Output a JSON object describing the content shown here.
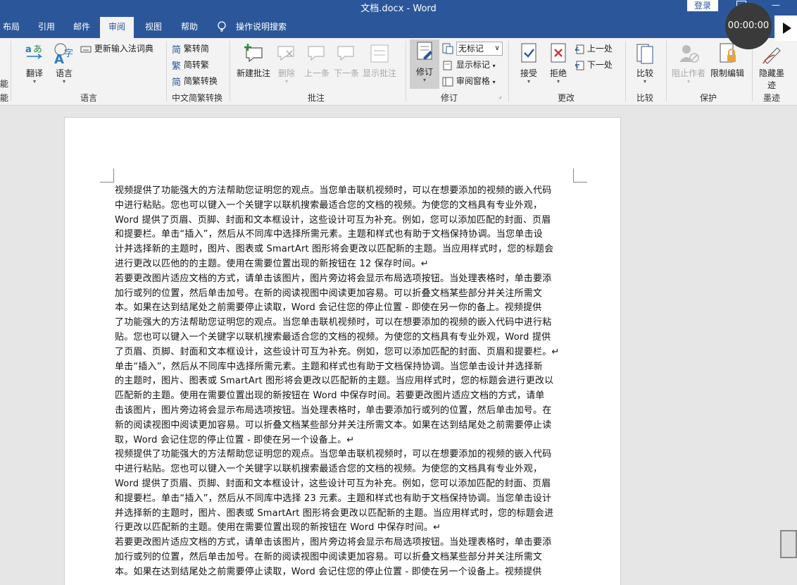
{
  "window": {
    "title": "文档.docx  -  Word",
    "login_label": "登录",
    "timer": "00:00:00"
  },
  "tabs": [
    {
      "label": "布局"
    },
    {
      "label": "引用"
    },
    {
      "label": "邮件"
    },
    {
      "label": "审阅"
    },
    {
      "label": "视图"
    },
    {
      "label": "帮助"
    }
  ],
  "tell_me": "操作说明搜索",
  "ribbon": {
    "left_cut": "能",
    "language": {
      "translate": "翻译",
      "lang": "语言",
      "update_ime": "更新输入法词典",
      "group": "语言"
    },
    "chinese": {
      "to_simplified": "繁转简",
      "to_traditional": "简转繁",
      "convert": "简繁转换",
      "group": "中文简繁转换"
    },
    "comments": {
      "new": "新建批注",
      "delete": "删除",
      "prev": "上一条",
      "next": "下一条",
      "show": "显示批注",
      "group": "批注"
    },
    "tracking": {
      "track": "修订",
      "markup_value": "无标记",
      "show_markup": "显示标记",
      "review_pane": "审阅窗格",
      "group": "修订"
    },
    "changes": {
      "accept": "接受",
      "reject": "拒绝",
      "prev": "上一处",
      "next": "下一处",
      "group": "更改"
    },
    "compare": {
      "compare": "比较",
      "group": "比较"
    },
    "protect": {
      "block_authors": "阻止作者",
      "restrict": "限制编辑",
      "group": "保护"
    },
    "ink": {
      "hide_ink_1": "隐藏墨",
      "hide_ink_2": "迹",
      "group": "墨迹"
    }
  },
  "document": {
    "lines": [
      "视频提供了功能强大的方法帮助您证明您的观点。当您单击联机视频时，可以在想要添加的视频的嵌入代码",
      "中进行粘贴。您也可以键入一个关键字以联机搜索最适合您的文档的视频。为使您的文档具有专业外观，",
      "Word 提供了页眉、页脚、封面和文本框设计，这些设计可互为补充。例如，您可以添加匹配的封面、页眉",
      "和提要栏。单击“插入”，然后从不同库中选择所需元素。主题和样式也有助于文档保持协调。当您单击设",
      "计并选择新的主题时，图片、图表或 SmartArt 图形将会更改以匹配新的主题。当应用样式时，您的标题会",
      "进行更改以匹他的的主题。使用在需要位置出现的新按钮在 12 保存时间。↵",
      "若要更改图片适应文档的方式，请单击该图片，图片旁边将会显示布局选项按钮。当处理表格时，单击要添",
      "加行或列的位置，然后单击加号。在新的阅读视图中阅读更加容易。可以折叠文档某些部分并关注所需文",
      "本。如果在达到结尾处之前需要停止读取，Word 会记住您的停止位置 - 即使在另一你的备上。视频提供",
      "了功能强大的方法帮助您证明您的观点。当您单击联机视频时，可以在想要添加的视频的嵌入代码中进行粘",
      "贴。您也可以键入一个关键字以联机搜索最适合您的文档的视频。为使您的文档具有专业外观，Word 提供",
      "了页眉、页脚、封面和文本框设计，这些设计可互为补充。例如，您可以添加匹配的封面、页眉和提要栏。↵",
      "单击“插入”，然后从不同库中选择所需元素。主题和样式也有助于文档保持协调。当您单击设计并选择新",
      "的主题时，图片、图表或 SmartArt 图形将会更改以匹配新的主题。当应用样式时，您的标题会进行更改以",
      "匹配新的主题。使用在需要位置出现的新按钮在 Word 中保存时间。若要更改图片适应文档的方式，请单",
      "击该图片，图片旁边将会显示布局选项按钮。当处理表格时，单击要添加行或列的位置，然后单击加号。在",
      "新的阅读视图中阅读更加容易。可以折叠文档某些部分并关注所需文本。如果在达到结尾处之前需要停止读",
      "取，Word 会记住您的停止位置 - 即使在另一个设备上。↵",
      "视频提供了功能强大的方法帮助您证明您的观点。当您单击联机视频时，可以在想要添加的视频的嵌入代码",
      "中进行粘贴。您也可以键入一个关键字以联机搜索最适合您的文档的视频。为使您的文档具有专业外观，",
      "Word 提供了页眉、页脚、封面和文本框设计，这些设计可互为补充。例如，您可以添加匹配的封面、页眉",
      "和提要栏。单击“插入”，然后从不同库中选择 23 元素。主题和样式也有助于文档保持协调。当您单击设计",
      "并选择新的主题时，图片、图表或 SmartArt 图形将会更改以匹配新的主题。当应用样式时，您的标题会进",
      "行更改以匹配新的主题。使用在需要位置出现的新按钮在 Word 中保存时间。↵",
      "若要更改图片适应文档的方式，请单击该图片，图片旁边将会显示布局选项按钮。当处理表格时，单击要添",
      "加行或列的位置，然后单击加号。在新的阅读视图中阅读更加容易。可以折叠文档某些部分并关注所需文",
      "本。如果在达到结尾处之前需要停止读取，Word 会记住您的停止位置 - 即使在另一个设备上。视频提供"
    ]
  }
}
